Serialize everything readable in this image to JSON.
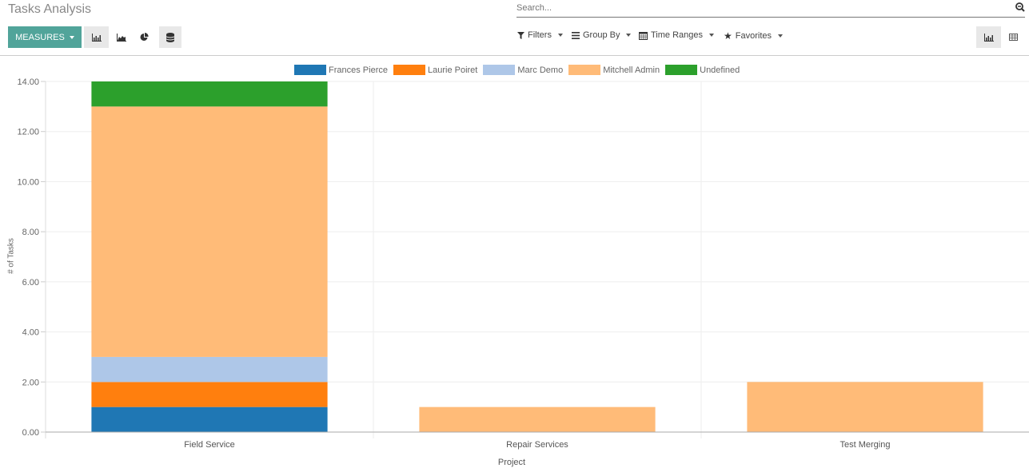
{
  "header": {
    "title": "Tasks Analysis",
    "search_placeholder": "Search...",
    "search_icon": "search-icon"
  },
  "toolbar": {
    "measures_label": "MEASURES",
    "chart_types": [
      {
        "name": "bar-chart-icon",
        "active": true
      },
      {
        "name": "line-chart-icon",
        "active": false
      },
      {
        "name": "pie-chart-icon",
        "active": false
      },
      {
        "name": "stacked-icon",
        "active": true
      }
    ],
    "filters_label": "Filters",
    "groupby_label": "Group By",
    "timeranges_label": "Time Ranges",
    "favorites_label": "Favorites",
    "views": [
      {
        "name": "graph-view-icon",
        "active": true
      },
      {
        "name": "pivot-view-icon",
        "active": false
      }
    ]
  },
  "chart_data": {
    "type": "bar",
    "stacked": true,
    "categories": [
      "Field Service",
      "Repair Services",
      "Test Merging"
    ],
    "series": [
      {
        "name": "Frances Pierce",
        "color": "#1f77b4",
        "values": [
          1,
          0,
          0
        ]
      },
      {
        "name": "Laurie Poiret",
        "color": "#ff7f0e",
        "values": [
          1,
          0,
          0
        ]
      },
      {
        "name": "Marc Demo",
        "color": "#aec7e8",
        "values": [
          1,
          0,
          0
        ]
      },
      {
        "name": "Mitchell Admin",
        "color": "#ffbb78",
        "values": [
          10,
          1,
          2
        ]
      },
      {
        "name": "Undefined",
        "color": "#2ca02c",
        "values": [
          1,
          0,
          0
        ]
      }
    ],
    "xlabel": "Project",
    "ylabel": "# of Tasks",
    "ylim": [
      0,
      14
    ],
    "yticks": [
      "0.00",
      "2.00",
      "4.00",
      "6.00",
      "8.00",
      "10.00",
      "12.00",
      "14.00"
    ],
    "grid": true,
    "legend": "top-center"
  }
}
